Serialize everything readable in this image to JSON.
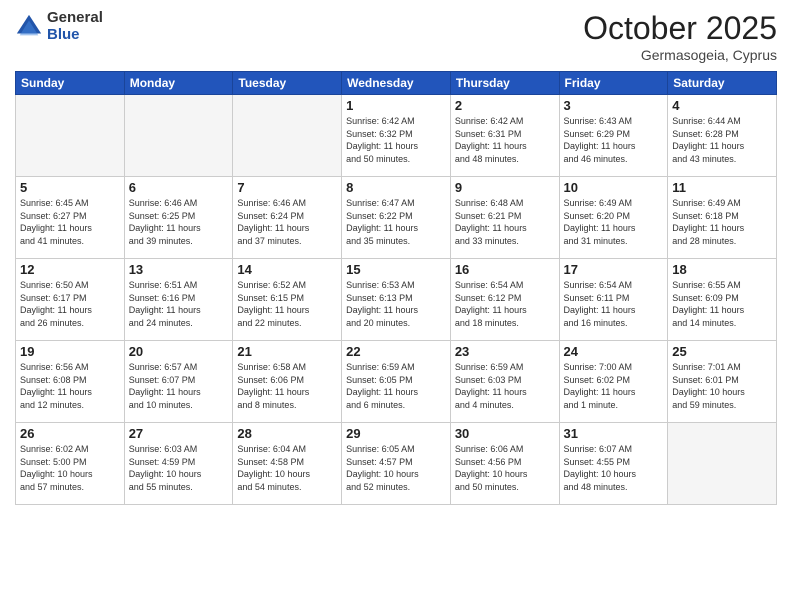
{
  "logo": {
    "general": "General",
    "blue": "Blue"
  },
  "title": "October 2025",
  "location": "Germasogeia, Cyprus",
  "headers": [
    "Sunday",
    "Monday",
    "Tuesday",
    "Wednesday",
    "Thursday",
    "Friday",
    "Saturday"
  ],
  "weeks": [
    [
      {
        "day": "",
        "info": ""
      },
      {
        "day": "",
        "info": ""
      },
      {
        "day": "",
        "info": ""
      },
      {
        "day": "1",
        "info": "Sunrise: 6:42 AM\nSunset: 6:32 PM\nDaylight: 11 hours\nand 50 minutes."
      },
      {
        "day": "2",
        "info": "Sunrise: 6:42 AM\nSunset: 6:31 PM\nDaylight: 11 hours\nand 48 minutes."
      },
      {
        "day": "3",
        "info": "Sunrise: 6:43 AM\nSunset: 6:29 PM\nDaylight: 11 hours\nand 46 minutes."
      },
      {
        "day": "4",
        "info": "Sunrise: 6:44 AM\nSunset: 6:28 PM\nDaylight: 11 hours\nand 43 minutes."
      }
    ],
    [
      {
        "day": "5",
        "info": "Sunrise: 6:45 AM\nSunset: 6:27 PM\nDaylight: 11 hours\nand 41 minutes."
      },
      {
        "day": "6",
        "info": "Sunrise: 6:46 AM\nSunset: 6:25 PM\nDaylight: 11 hours\nand 39 minutes."
      },
      {
        "day": "7",
        "info": "Sunrise: 6:46 AM\nSunset: 6:24 PM\nDaylight: 11 hours\nand 37 minutes."
      },
      {
        "day": "8",
        "info": "Sunrise: 6:47 AM\nSunset: 6:22 PM\nDaylight: 11 hours\nand 35 minutes."
      },
      {
        "day": "9",
        "info": "Sunrise: 6:48 AM\nSunset: 6:21 PM\nDaylight: 11 hours\nand 33 minutes."
      },
      {
        "day": "10",
        "info": "Sunrise: 6:49 AM\nSunset: 6:20 PM\nDaylight: 11 hours\nand 31 minutes."
      },
      {
        "day": "11",
        "info": "Sunrise: 6:49 AM\nSunset: 6:18 PM\nDaylight: 11 hours\nand 28 minutes."
      }
    ],
    [
      {
        "day": "12",
        "info": "Sunrise: 6:50 AM\nSunset: 6:17 PM\nDaylight: 11 hours\nand 26 minutes."
      },
      {
        "day": "13",
        "info": "Sunrise: 6:51 AM\nSunset: 6:16 PM\nDaylight: 11 hours\nand 24 minutes."
      },
      {
        "day": "14",
        "info": "Sunrise: 6:52 AM\nSunset: 6:15 PM\nDaylight: 11 hours\nand 22 minutes."
      },
      {
        "day": "15",
        "info": "Sunrise: 6:53 AM\nSunset: 6:13 PM\nDaylight: 11 hours\nand 20 minutes."
      },
      {
        "day": "16",
        "info": "Sunrise: 6:54 AM\nSunset: 6:12 PM\nDaylight: 11 hours\nand 18 minutes."
      },
      {
        "day": "17",
        "info": "Sunrise: 6:54 AM\nSunset: 6:11 PM\nDaylight: 11 hours\nand 16 minutes."
      },
      {
        "day": "18",
        "info": "Sunrise: 6:55 AM\nSunset: 6:09 PM\nDaylight: 11 hours\nand 14 minutes."
      }
    ],
    [
      {
        "day": "19",
        "info": "Sunrise: 6:56 AM\nSunset: 6:08 PM\nDaylight: 11 hours\nand 12 minutes."
      },
      {
        "day": "20",
        "info": "Sunrise: 6:57 AM\nSunset: 6:07 PM\nDaylight: 11 hours\nand 10 minutes."
      },
      {
        "day": "21",
        "info": "Sunrise: 6:58 AM\nSunset: 6:06 PM\nDaylight: 11 hours\nand 8 minutes."
      },
      {
        "day": "22",
        "info": "Sunrise: 6:59 AM\nSunset: 6:05 PM\nDaylight: 11 hours\nand 6 minutes."
      },
      {
        "day": "23",
        "info": "Sunrise: 6:59 AM\nSunset: 6:03 PM\nDaylight: 11 hours\nand 4 minutes."
      },
      {
        "day": "24",
        "info": "Sunrise: 7:00 AM\nSunset: 6:02 PM\nDaylight: 11 hours\nand 1 minute."
      },
      {
        "day": "25",
        "info": "Sunrise: 7:01 AM\nSunset: 6:01 PM\nDaylight: 10 hours\nand 59 minutes."
      }
    ],
    [
      {
        "day": "26",
        "info": "Sunrise: 6:02 AM\nSunset: 5:00 PM\nDaylight: 10 hours\nand 57 minutes."
      },
      {
        "day": "27",
        "info": "Sunrise: 6:03 AM\nSunset: 4:59 PM\nDaylight: 10 hours\nand 55 minutes."
      },
      {
        "day": "28",
        "info": "Sunrise: 6:04 AM\nSunset: 4:58 PM\nDaylight: 10 hours\nand 54 minutes."
      },
      {
        "day": "29",
        "info": "Sunrise: 6:05 AM\nSunset: 4:57 PM\nDaylight: 10 hours\nand 52 minutes."
      },
      {
        "day": "30",
        "info": "Sunrise: 6:06 AM\nSunset: 4:56 PM\nDaylight: 10 hours\nand 50 minutes."
      },
      {
        "day": "31",
        "info": "Sunrise: 6:07 AM\nSunset: 4:55 PM\nDaylight: 10 hours\nand 48 minutes."
      },
      {
        "day": "",
        "info": ""
      }
    ]
  ]
}
